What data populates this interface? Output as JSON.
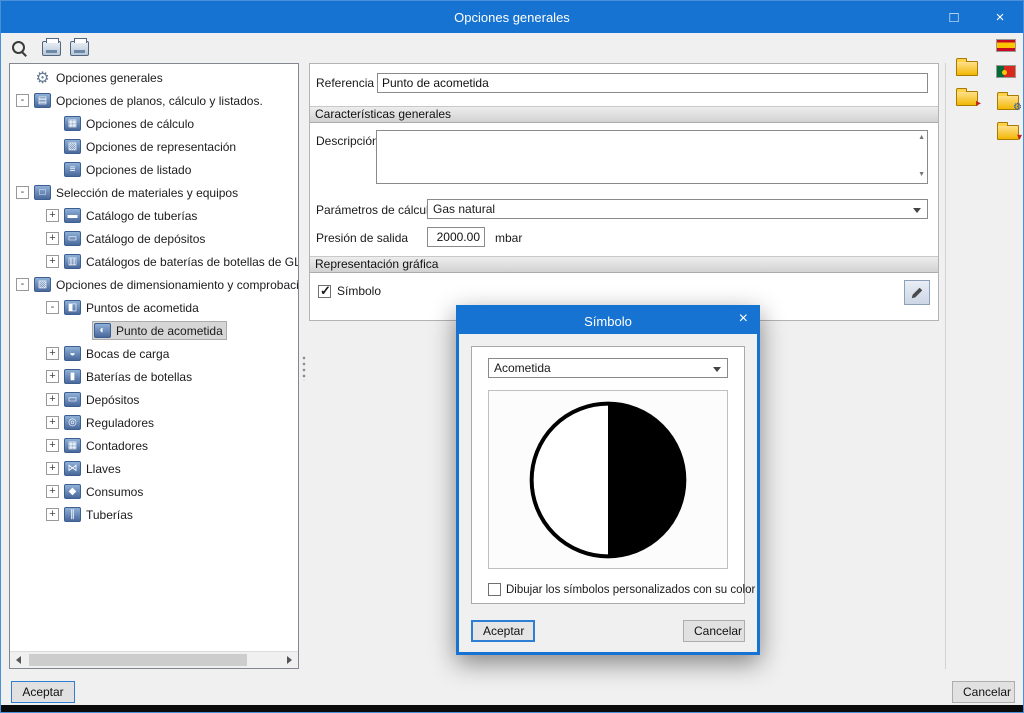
{
  "window": {
    "title": "Opciones generales",
    "maximize_glyph": "□",
    "close_glyph": "×"
  },
  "toolbar": {
    "icons": [
      "search-icon",
      "print-icon",
      "print-preview-icon"
    ]
  },
  "tree": {
    "items": [
      {
        "label": "Opciones generales",
        "level": 0,
        "expander": null,
        "icon": "gear-icon",
        "selected": false
      },
      {
        "label": "Opciones de planos, cálculo y listados.",
        "level": 0,
        "expander": "minus",
        "icon": "plans-icon",
        "selected": false
      },
      {
        "label": "Opciones de cálculo",
        "level": 1,
        "expander": null,
        "icon": "calc-options-icon",
        "selected": false
      },
      {
        "label": "Opciones de representación",
        "level": 1,
        "expander": null,
        "icon": "representation-options-icon",
        "selected": false
      },
      {
        "label": "Opciones de listado",
        "level": 1,
        "expander": null,
        "icon": "listing-options-icon",
        "selected": false
      },
      {
        "label": "Selección de materiales y equipos",
        "level": 0,
        "expander": "minus",
        "icon": "materials-icon",
        "selected": false
      },
      {
        "label": "Catálogo de tuberías",
        "level": 1,
        "expander": "plus",
        "icon": "pipes-catalog-icon",
        "selected": false
      },
      {
        "label": "Catálogo de depósitos",
        "level": 1,
        "expander": "plus",
        "icon": "tanks-catalog-icon",
        "selected": false
      },
      {
        "label": "Catálogos de baterías de botellas de GLP",
        "level": 1,
        "expander": "plus",
        "icon": "glp-catalog-icon",
        "selected": false
      },
      {
        "label": "Opciones de dimensionamiento y comprobación",
        "level": 0,
        "expander": "minus",
        "icon": "dimensioning-icon",
        "selected": false
      },
      {
        "label": "Puntos de acometida",
        "level": 1,
        "expander": "minus",
        "icon": "supply-points-icon",
        "selected": false
      },
      {
        "label": "Punto de acometida",
        "level": 2,
        "expander": null,
        "icon": "supply-point-icon",
        "selected": true
      },
      {
        "label": "Bocas de carga",
        "level": 1,
        "expander": "plus",
        "icon": "filling-points-icon",
        "selected": false
      },
      {
        "label": "Baterías de botellas",
        "level": 1,
        "expander": "plus",
        "icon": "bottle-batteries-icon",
        "selected": false
      },
      {
        "label": "Depósitos",
        "level": 1,
        "expander": "plus",
        "icon": "tanks-icon",
        "selected": false
      },
      {
        "label": "Reguladores",
        "level": 1,
        "expander": "plus",
        "icon": "regulators-icon",
        "selected": false
      },
      {
        "label": "Contadores",
        "level": 1,
        "expander": "plus",
        "icon": "meters-icon",
        "selected": false
      },
      {
        "label": "Llaves",
        "level": 1,
        "expander": "plus",
        "icon": "valves-icon",
        "selected": false
      },
      {
        "label": "Consumos",
        "level": 1,
        "expander": "plus",
        "icon": "consumption-icon",
        "selected": false
      },
      {
        "label": "Tuberías",
        "level": 1,
        "expander": "plus",
        "icon": "pipes-icon",
        "selected": false
      }
    ]
  },
  "form": {
    "referencia": {
      "label": "Referencia",
      "value": "Punto de acometida"
    },
    "caracteristicas": {
      "header": "Características generales",
      "descripcion_label": "Descripción",
      "descripcion_value": "",
      "parametros_label": "Parámetros de cálculo",
      "parametros_value": "Gas natural",
      "presion_label": "Presión de salida",
      "presion_value": "2000.00",
      "presion_unit": "mbar"
    },
    "representacion": {
      "header": "Representación gráfica",
      "simbolo_label": "Símbolo",
      "simbolo_checked": true
    }
  },
  "side_toolbar": {
    "icons": [
      "spain-flag-icon",
      "portugal-flag-icon",
      "open-options-icon",
      "save-options-icon",
      "config-options-icon",
      "import-options-icon"
    ]
  },
  "symbol_dialog": {
    "title": "Símbolo",
    "close_glyph": "×",
    "symbol_select_value": "Acometida",
    "color_checkbox_label": "Dibujar los símbolos personalizados con su color",
    "color_checkbox_checked": false,
    "accept_label": "Aceptar",
    "cancel_label": "Cancelar"
  },
  "footer": {
    "accept_label": "Aceptar",
    "cancel_label": "Cancelar"
  }
}
